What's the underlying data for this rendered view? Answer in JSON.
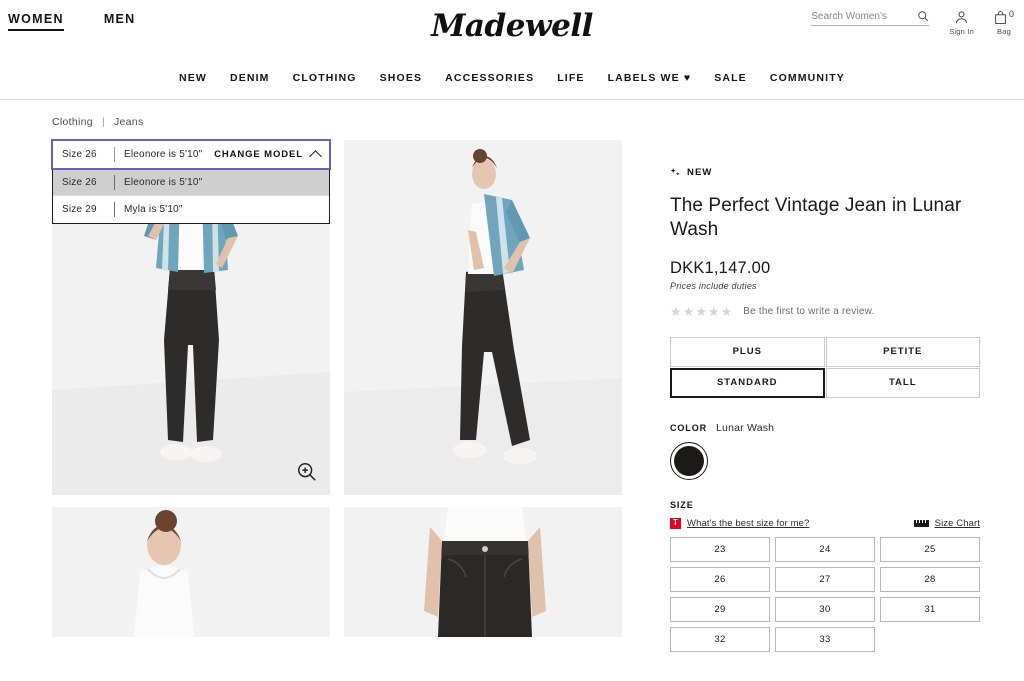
{
  "header": {
    "gender_nav": [
      {
        "label": "WOMEN",
        "active": true
      },
      {
        "label": "MEN",
        "active": false
      }
    ],
    "logo": "Madewell",
    "search": {
      "placeholder": "Search Women's",
      "value": "",
      "icon": "search-icon"
    },
    "sign_in": {
      "label": "Sign In",
      "icon": "user-icon"
    },
    "bag": {
      "label": "Bag",
      "count": "0",
      "icon": "bag-icon"
    }
  },
  "main_nav": [
    {
      "label": "NEW"
    },
    {
      "label": "DENIM"
    },
    {
      "label": "CLOTHING"
    },
    {
      "label": "SHOES"
    },
    {
      "label": "ACCESSORIES"
    },
    {
      "label": "LIFE"
    },
    {
      "label": "LABELS WE ♥"
    },
    {
      "label": "SALE"
    },
    {
      "label": "COMMUNITY"
    }
  ],
  "breadcrumb": {
    "items": [
      "Clothing",
      "Jeans"
    ],
    "separator": "|"
  },
  "model_selector": {
    "current": {
      "size": "Size 26",
      "model": "Eleonore is 5'10\""
    },
    "change_label": "CHANGE MODEL",
    "caret": "chevron-up-icon",
    "expanded": true,
    "options": [
      {
        "size": "Size 26",
        "model": "Eleonore is 5'10\"",
        "selected": true
      },
      {
        "size": "Size 29",
        "model": "Myla is 5'10\"",
        "selected": false
      }
    ]
  },
  "gallery": {
    "zoom_icon": "zoom-in-icon",
    "photos": [
      {
        "alt": "Model in striped shirt and black jeans, front view",
        "variant": "front-full"
      },
      {
        "alt": "Model in striped shirt and black jeans, side view",
        "variant": "side-full"
      },
      {
        "alt": "Model back view in white tank top",
        "variant": "back-crop"
      },
      {
        "alt": "Close-up of black jeans waistband",
        "variant": "waist-crop"
      }
    ]
  },
  "product": {
    "badge": {
      "label": "NEW",
      "icon": "sparkle-icon"
    },
    "title": "The Perfect Vintage Jean in Lunar Wash",
    "price": "DKK1,147.00",
    "duties_note": "Prices include duties",
    "rating": {
      "stars": 5,
      "filled": 0,
      "star_color": "#d6d6d6",
      "review_text": "Be the first to write a review."
    },
    "fits": [
      {
        "label": "PLUS",
        "selected": false
      },
      {
        "label": "PETITE",
        "selected": false
      },
      {
        "label": "STANDARD",
        "selected": true
      },
      {
        "label": "TALL",
        "selected": false
      }
    ],
    "color": {
      "label": "COLOR",
      "value": "Lunar Wash",
      "swatch_hex": "#1c1a18"
    },
    "size": {
      "label": "SIZE",
      "help_link": "What's the best size for me?",
      "help_icon": "truefit-icon",
      "help_icon_glyph": "T",
      "help_icon_color": "#e5001c",
      "size_chart_link": "Size Chart",
      "size_chart_icon": "ruler-icon",
      "options": [
        "23",
        "24",
        "25",
        "26",
        "27",
        "28",
        "29",
        "30",
        "31",
        "32",
        "33"
      ]
    }
  }
}
